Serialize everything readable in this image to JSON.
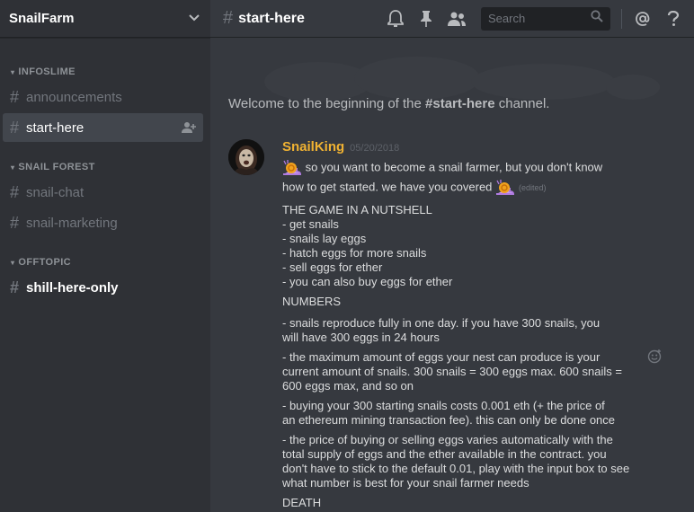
{
  "server": {
    "name": "SnailFarm"
  },
  "sidebar": {
    "categories": [
      {
        "name": "INFOSLIME",
        "channels": [
          {
            "name": "announcements",
            "state": "muted"
          },
          {
            "name": "start-here",
            "state": "selected"
          }
        ]
      },
      {
        "name": "SNAIL FOREST",
        "channels": [
          {
            "name": "snail-chat",
            "state": "muted"
          },
          {
            "name": "snail-marketing",
            "state": "muted"
          }
        ]
      },
      {
        "name": "OFFTOPIC",
        "channels": [
          {
            "name": "shill-here-only",
            "state": "unread"
          }
        ]
      }
    ]
  },
  "header": {
    "channel": "start-here",
    "search_placeholder": "Search",
    "icons": [
      "bell-icon",
      "pin-icon",
      "members-icon",
      "search-icon",
      "mention-icon",
      "help-icon"
    ]
  },
  "main": {
    "welcome_prefix": "Welcome to the beginning of the ",
    "welcome_channel": "#start-here",
    "welcome_suffix": " channel.",
    "message": {
      "author": "SnailKing",
      "author_color": "#f0b232",
      "timestamp": "05/20/2018",
      "intro_1": " so you want to become a snail farmer, but you don't know",
      "intro_2": "how to get started. we have you covered ",
      "edited": "(edited)",
      "section_1": "THE GAME IN A NUTSHELL",
      "bullets_1": [
        "- get snails",
        "- snails lay eggs",
        "- hatch eggs for more snails",
        "- sell eggs for ether",
        "- you can also buy eggs for ether"
      ],
      "section_2": "NUMBERS",
      "n1_a": "- snails reproduce fully in one day. if you have 300 snails, you",
      "n1_b": "will have 300 eggs in 24 hours",
      "n2_a": "- the maximum amount of eggs your nest can produce is your",
      "n2_b": "current amount of snails. 300 snails = 300 eggs max. 600 snails =",
      "n2_c": "600 eggs max, and so on",
      "n3_a": "- buying your 300 starting snails costs 0.001 eth (+ the price of",
      "n3_b": "an ethereum mining transaction fee). this can only be done once",
      "n4_a": "- the price of buying or selling eggs varies automatically with the",
      "n4_b": "total supply of eggs and the ether available in the contract. you",
      "n4_c": "don't have to stick to the default 0.01, play with the input box to see",
      "n4_d": "what number is best for your snail farmer needs",
      "section_3": "DEATH"
    }
  }
}
